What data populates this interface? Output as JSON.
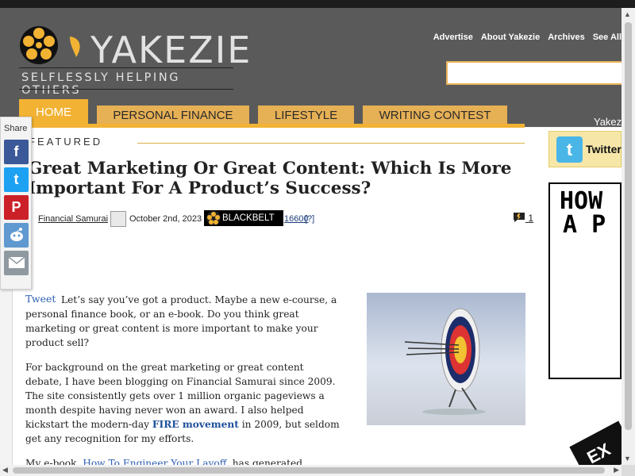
{
  "brand": {
    "name": "YAKEZIE",
    "tagline": "SELFLESSLY HELPING OTHERS"
  },
  "top_links": [
    "Advertise",
    "About Yakezie",
    "Archives",
    "See All"
  ],
  "nav": {
    "tabs": [
      "HOME",
      "PERSONAL FINANCE",
      "LIFESTYLE",
      "WRITING CONTEST"
    ],
    "right_label": "Yakez"
  },
  "featured_label": "FEATURED",
  "article": {
    "title": "Great Marketing Or Great Content: Which Is More Important For A Product’s Success?",
    "by_prefix": "y",
    "author": "Financial Samurai",
    "date": "October 2nd, 2023",
    "badge": "BLACKBELT",
    "badge_points": "16600",
    "badge_help": "[?]",
    "comments_count": "1",
    "tweet_label": "Tweet",
    "p1": "Let’s say you’ve got a product. Maybe a new e-course, a personal finance book, or an e-book. Do you think great marketing or great content is more important to make your product sell?",
    "p2_before": "For background on the great marketing or great content debate, I have been blogging on Financial Samurai since 2009. The site consistently gets over 1 million organic pageviews a month despite having never won an award. I also helped kickstart the modern-day ",
    "p2_link": "FIRE movement",
    "p2_after": " in 2009, but seldom get any recognition for my efforts.",
    "p3_before": "My e-book, ",
    "p3_link": "How To Engineer Your Layoff",
    "p3_after": ", has generated"
  },
  "sidebar": {
    "twitter_label": "Twitter",
    "howto_line1": "HOW",
    "howto_line2": "A P",
    "promo_text": "EX"
  },
  "share": {
    "label": "Share"
  },
  "colors": {
    "accent": "#f2b233",
    "tab": "#e6b055",
    "header": "#5a5a5a",
    "link": "#2a5db0",
    "facebook": "#3b5998",
    "twitter": "#1da1f2",
    "pinterest": "#cb2027",
    "reddit": "#5f99cf",
    "email": "#8e9aa0"
  }
}
